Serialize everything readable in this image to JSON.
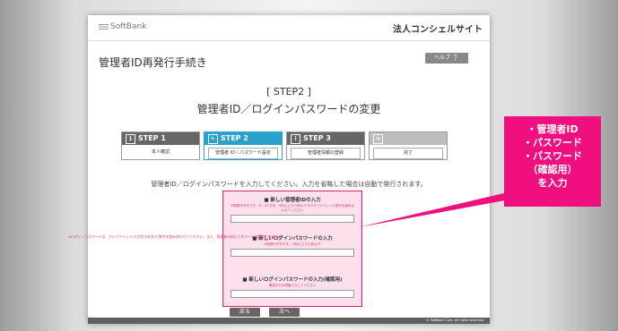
{
  "header": {
    "logo_text": "SoftBank",
    "site_title": "法人コンシェルサイト"
  },
  "page": {
    "title": "管理者ID再発行手続き",
    "help_label": "ヘルプ ❔"
  },
  "step": {
    "label": "[ STEP2 ]",
    "title": "管理者ID／ログインパスワードの変更"
  },
  "steps": [
    {
      "label": "STEP 1",
      "sub": "本人確認",
      "icon": "1"
    },
    {
      "label": "STEP 2",
      "sub": "管理者 ID / パスワード設定",
      "icon": "✎"
    },
    {
      "label": "STEP 3",
      "sub": "管理者情報の登録",
      "icon": "i"
    },
    {
      "label": "",
      "sub": "完了",
      "icon": "✉"
    }
  ],
  "intro": "管理者ID／ログインパスワードを入力してください。入力を省略した場合は自動で発行されます。",
  "side_note": "※ログインパスワードは、アルファベット(大文字小文字)と数字を組み合わせてください。また、管理者ID同じパスワードは設定できません。",
  "form": {
    "field1": {
      "label": "■ 新しい管理者IDの入力",
      "note": "※再発行不可です。 8 - 20 文字、9桁以上で11桁以下\n※アルファベットと数字を組み合わせてください"
    },
    "field2": {
      "label": "■ 新しいログインパスワードの入力",
      "note": "※再発行不可です。 8桁以上で11桁以下"
    },
    "field3": {
      "label": "■ 新しいログインパスワードの入力(確認用)",
      "note": "確認のため再度入力してください"
    }
  },
  "buttons": {
    "back": "戻る",
    "next": "次へ"
  },
  "footer": {
    "copyright": "© SoftBank Corp. All rights reserved."
  },
  "callout": {
    "lines": [
      "・管理者ID",
      "・パスワード",
      "・パスワード",
      "（確認用）",
      "を入力"
    ]
  },
  "colors": {
    "callout": "#f00f7f",
    "active_step": "#29a3cc",
    "form_border": "#e8157e"
  }
}
